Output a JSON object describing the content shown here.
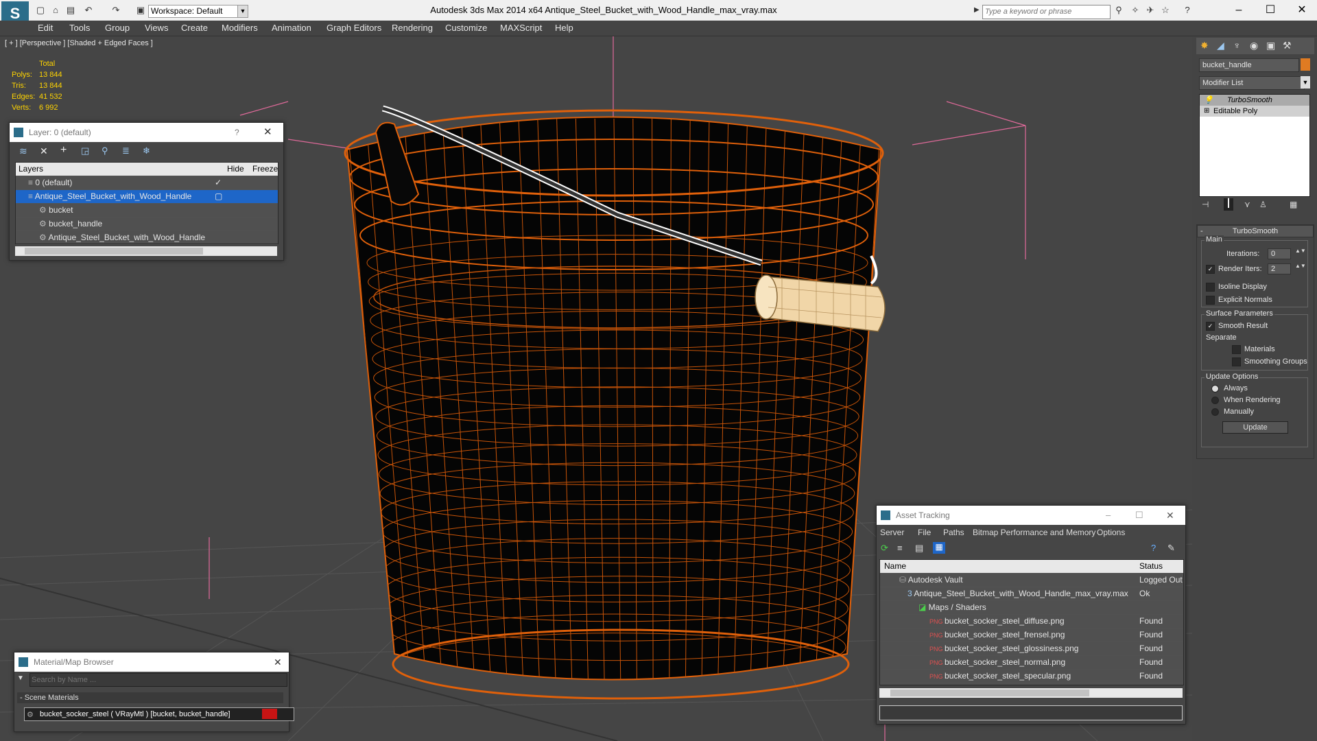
{
  "app": {
    "title": "Autodesk 3ds Max  2014 x64      Antique_Steel_Bucket_with_Wood_Handle_max_vray.max",
    "workspace": "Workspace: Default",
    "search_placeholder": "Type a keyword or phrase"
  },
  "menu": [
    "Edit",
    "Tools",
    "Group",
    "Views",
    "Create",
    "Modifiers",
    "Animation",
    "Graph Editors",
    "Rendering",
    "Customize",
    "MAXScript",
    "Help"
  ],
  "viewport": {
    "label": "[ + ] [Perspective ] [Shaded + Edged Faces ]",
    "stats": {
      "header": "Total",
      "rows": [
        {
          "k": "Polys:",
          "v": "13 844"
        },
        {
          "k": "Tris:",
          "v": "13 844"
        },
        {
          "k": "Edges:",
          "v": "41 532"
        },
        {
          "k": "Verts:",
          "v": "6 992"
        }
      ]
    }
  },
  "layer_dialog": {
    "title": "Layer: 0 (default)",
    "help": "?",
    "columns": [
      "Layers",
      "Hide",
      "Freeze"
    ],
    "rows": [
      {
        "name": "0 (default)",
        "indent": 0,
        "selected": false
      },
      {
        "name": "Antique_Steel_Bucket_with_Wood_Handle",
        "indent": 0,
        "selected": true
      },
      {
        "name": "bucket",
        "indent": 1,
        "selected": false
      },
      {
        "name": "bucket_handle",
        "indent": 1,
        "selected": false
      },
      {
        "name": "Antique_Steel_Bucket_with_Wood_Handle",
        "indent": 1,
        "selected": false
      }
    ]
  },
  "material_browser": {
    "title": "Material/Map Browser",
    "search_placeholder": "Search by Name ...",
    "group": "- Scene Materials",
    "item": "bucket_socker_steel  ( VRayMtl ) [bucket, bucket_handle]"
  },
  "asset_tracking": {
    "title": "Asset Tracking",
    "menu": [
      "Server",
      "File",
      "Paths",
      "Bitmap Performance and Memory",
      "Options"
    ],
    "columns": [
      "Name",
      "Status"
    ],
    "rows": [
      {
        "name": "Autodesk Vault",
        "status": "Logged Out",
        "indent": 1
      },
      {
        "name": "Antique_Steel_Bucket_with_Wood_Handle_max_vray.max",
        "status": "Ok",
        "indent": 2
      },
      {
        "name": "Maps / Shaders",
        "status": "",
        "indent": 3
      },
      {
        "name": "bucket_socker_steel_diffuse.png",
        "status": "Found",
        "indent": 4
      },
      {
        "name": "bucket_socker_steel_frensel.png",
        "status": "Found",
        "indent": 4
      },
      {
        "name": "bucket_socker_steel_glossiness.png",
        "status": "Found",
        "indent": 4
      },
      {
        "name": "bucket_socker_steel_normal.png",
        "status": "Found",
        "indent": 4
      },
      {
        "name": "bucket_socker_steel_specular.png",
        "status": "Found",
        "indent": 4
      }
    ]
  },
  "command_panel": {
    "object_name": "bucket_handle",
    "modifier_list": "Modifier List",
    "stack": [
      "TurboSmooth",
      "Editable Poly"
    ],
    "turbosmooth": {
      "header": "TurboSmooth",
      "main": "Main",
      "iterations_label": "Iterations:",
      "iterations": "0",
      "render_iters_label": "Render Iters:",
      "render_iters": "2",
      "isoline": "Isoline Display",
      "explicit_normals": "Explicit Normals",
      "surface_params": "Surface Parameters",
      "smooth_result": "Smooth Result",
      "separate": "Separate",
      "materials": "Materials",
      "smoothing_groups": "Smoothing Groups",
      "update_options": "Update Options",
      "always": "Always",
      "when_rendering": "When Rendering",
      "manually": "Manually",
      "update_btn": "Update"
    }
  },
  "colors": {
    "wire": "#e0600a",
    "selection": "#1e66c8",
    "object_color": "#e07b22"
  }
}
